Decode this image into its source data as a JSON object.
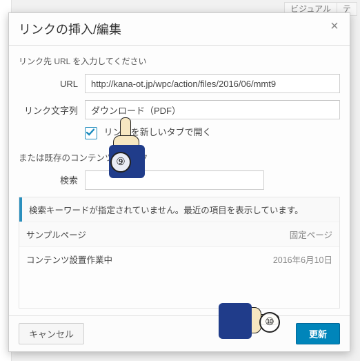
{
  "bg": {
    "tab_visual": "ビジュアル",
    "tab_text_partial": "テ"
  },
  "modal": {
    "title": "リンクの挿入/編集",
    "instruction": "リンク先 URL を入力してください",
    "url_label": "URL",
    "url_value": "http://kana-ot.jp/wpc/action/files/2016/06/mmt9",
    "linktext_label": "リンク文字列",
    "linktext_value": "ダウンロード（PDF）",
    "newtab_label": "リンクを新しいタブで開く",
    "newtab_checked": true,
    "section_existing": "または既存のコンテンツにリンク",
    "search_label": "検索",
    "search_value": "",
    "results": {
      "notice": "検索キーワードが指定されていません。最近の項目を表示しています。",
      "items": [
        {
          "title": "サンプルページ",
          "meta": "固定ページ"
        },
        {
          "title": "コンテンツ設置作業中",
          "meta": "2016年6月10日"
        }
      ]
    },
    "cancel": "キャンセル",
    "submit": "更新"
  },
  "annotations": {
    "marker9": "⑨",
    "marker10": "⑩"
  }
}
